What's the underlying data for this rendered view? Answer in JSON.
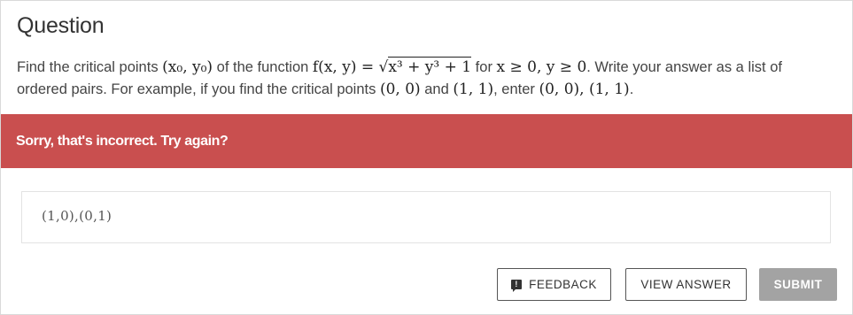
{
  "question": {
    "title": "Question",
    "text_1": "Find the critical points ",
    "point": "(x₀, y₀)",
    "text_2": " of the function ",
    "function_lhs": "f(x, y) = ",
    "function_sqrt": "x³ + y³ + 1",
    "text_3": " for ",
    "condition": "x ≥ 0, y ≥ 0",
    "text_4": ". Write your answer as a list of ordered pairs. For example, if you find the critical points ",
    "example_1": "(0, 0)",
    "text_5": " and ",
    "example_2": "(1, 1)",
    "text_6": ", enter ",
    "example_entry": "(0, 0), (1, 1)",
    "text_7": "."
  },
  "feedback": {
    "message": "Sorry, that's incorrect. Try again?",
    "color": "#c94f4f"
  },
  "answer": {
    "value": "(1,0),(0,1)"
  },
  "actions": {
    "feedback_label": "FEEDBACK",
    "feedback_icon": "exclamation-speech-bubble-icon",
    "view_answer_label": "VIEW ANSWER",
    "submit_label": "SUBMIT"
  }
}
